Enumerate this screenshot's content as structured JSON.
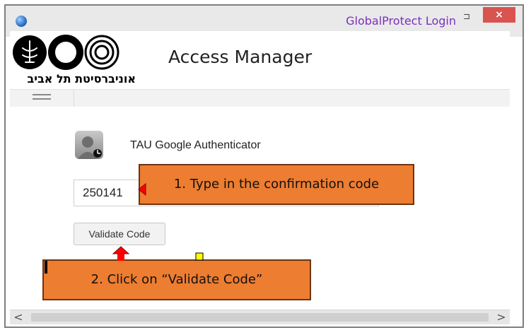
{
  "window": {
    "title": "GlobalProtect Login",
    "close_glyph": "×",
    "restore_glyph": "⊐"
  },
  "header": {
    "logo_text": "אוניברסיטת תל אביב",
    "title": "Access Manager"
  },
  "nav": {
    "menu_icon": "hamburger-icon"
  },
  "authenticator": {
    "icon": "authenticator-user-icon",
    "label": "TAU Google Authenticator"
  },
  "form": {
    "code_value": "250141",
    "validate_label": "Validate Code"
  },
  "annotations": {
    "step1": "1. Type in the confirmation code",
    "step2": "2. Click on “Validate Code”"
  },
  "scrollbar": {
    "left_glyph": "<",
    "right_glyph": ">"
  },
  "colors": {
    "callout_fill": "#ed7d31",
    "arrow_red": "#ff0000",
    "title_purple": "#7a2fbf",
    "close_red": "#d9534f"
  }
}
